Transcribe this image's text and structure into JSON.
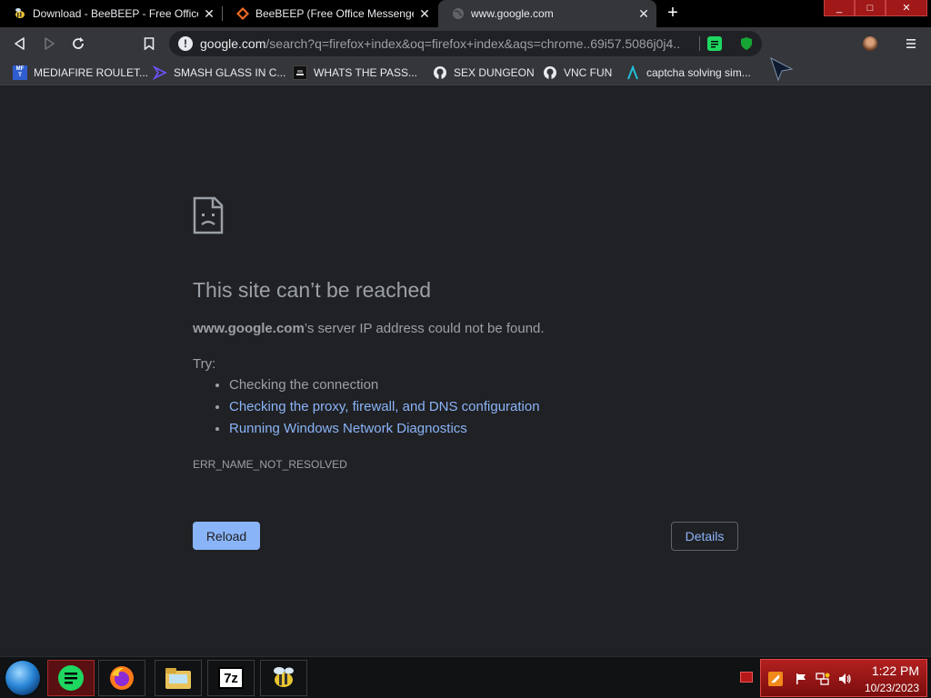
{
  "browser": {
    "tabs": [
      {
        "title": "Download - BeeBEEP - Free Office",
        "favicon": "beebeep-icon"
      },
      {
        "title": "BeeBEEP (Free Office Messenger) d",
        "favicon": "sourceforge-icon"
      },
      {
        "title": "www.google.com",
        "favicon": "globe-icon"
      }
    ],
    "active_tab": 2,
    "window_controls": {
      "minimize": "_",
      "maximize": "□",
      "close": "✕"
    }
  },
  "toolbar": {
    "url_host": "google.com",
    "url_rest": "/search?q=firefox+index&oq=firefox+index&aqs=chrome..69i57.5086j0j4..."
  },
  "bookmarks": [
    {
      "label": "MEDIAFIRE ROULET...",
      "icon": "mediafire-icon",
      "icon_text": "MF T",
      "color": "#2f5ed0"
    },
    {
      "label": "SMASH GLASS IN C...",
      "icon": "chevron-bookmark-icon",
      "color": "#5b3fd6"
    },
    {
      "label": "WHATS THE PASS...",
      "icon": "terminal-icon",
      "color": "#111111"
    },
    {
      "label": "SEX DUNGEON",
      "icon": "github-icon",
      "color": "#e8eaed"
    },
    {
      "label": "VNC FUN",
      "icon": "github-icon",
      "color": "#e8eaed"
    },
    {
      "label": "captcha solving sim...",
      "icon": "lambda-icon",
      "color": "#1fbfd8"
    }
  ],
  "error_page": {
    "title": "This site can’t be reached",
    "summary_host": "www.google.com",
    "summary_rest": "’s server IP address could not be found.",
    "try_label": "Try:",
    "suggestions": [
      {
        "text": "Checking the connection",
        "link": false
      },
      {
        "text": "Checking the proxy, firewall, and DNS configuration",
        "link": true
      },
      {
        "text": "Running Windows Network Diagnostics",
        "link": true
      }
    ],
    "error_code": "ERR_NAME_NOT_RESOLVED",
    "reload_label": "Reload",
    "details_label": "Details"
  },
  "taskbar": {
    "apps": [
      "notes-app-icon",
      "firefox-icon",
      "file-explorer-icon",
      "7zip-icon",
      "beebeep-icon"
    ],
    "seven_zip_label": "7z",
    "time": "1:22 PM",
    "date": "10/23/2023"
  },
  "colors": {
    "page_bg": "#202124",
    "link": "#8ab4f8",
    "text": "#9aa0a6",
    "accent_red": "#a01818"
  }
}
